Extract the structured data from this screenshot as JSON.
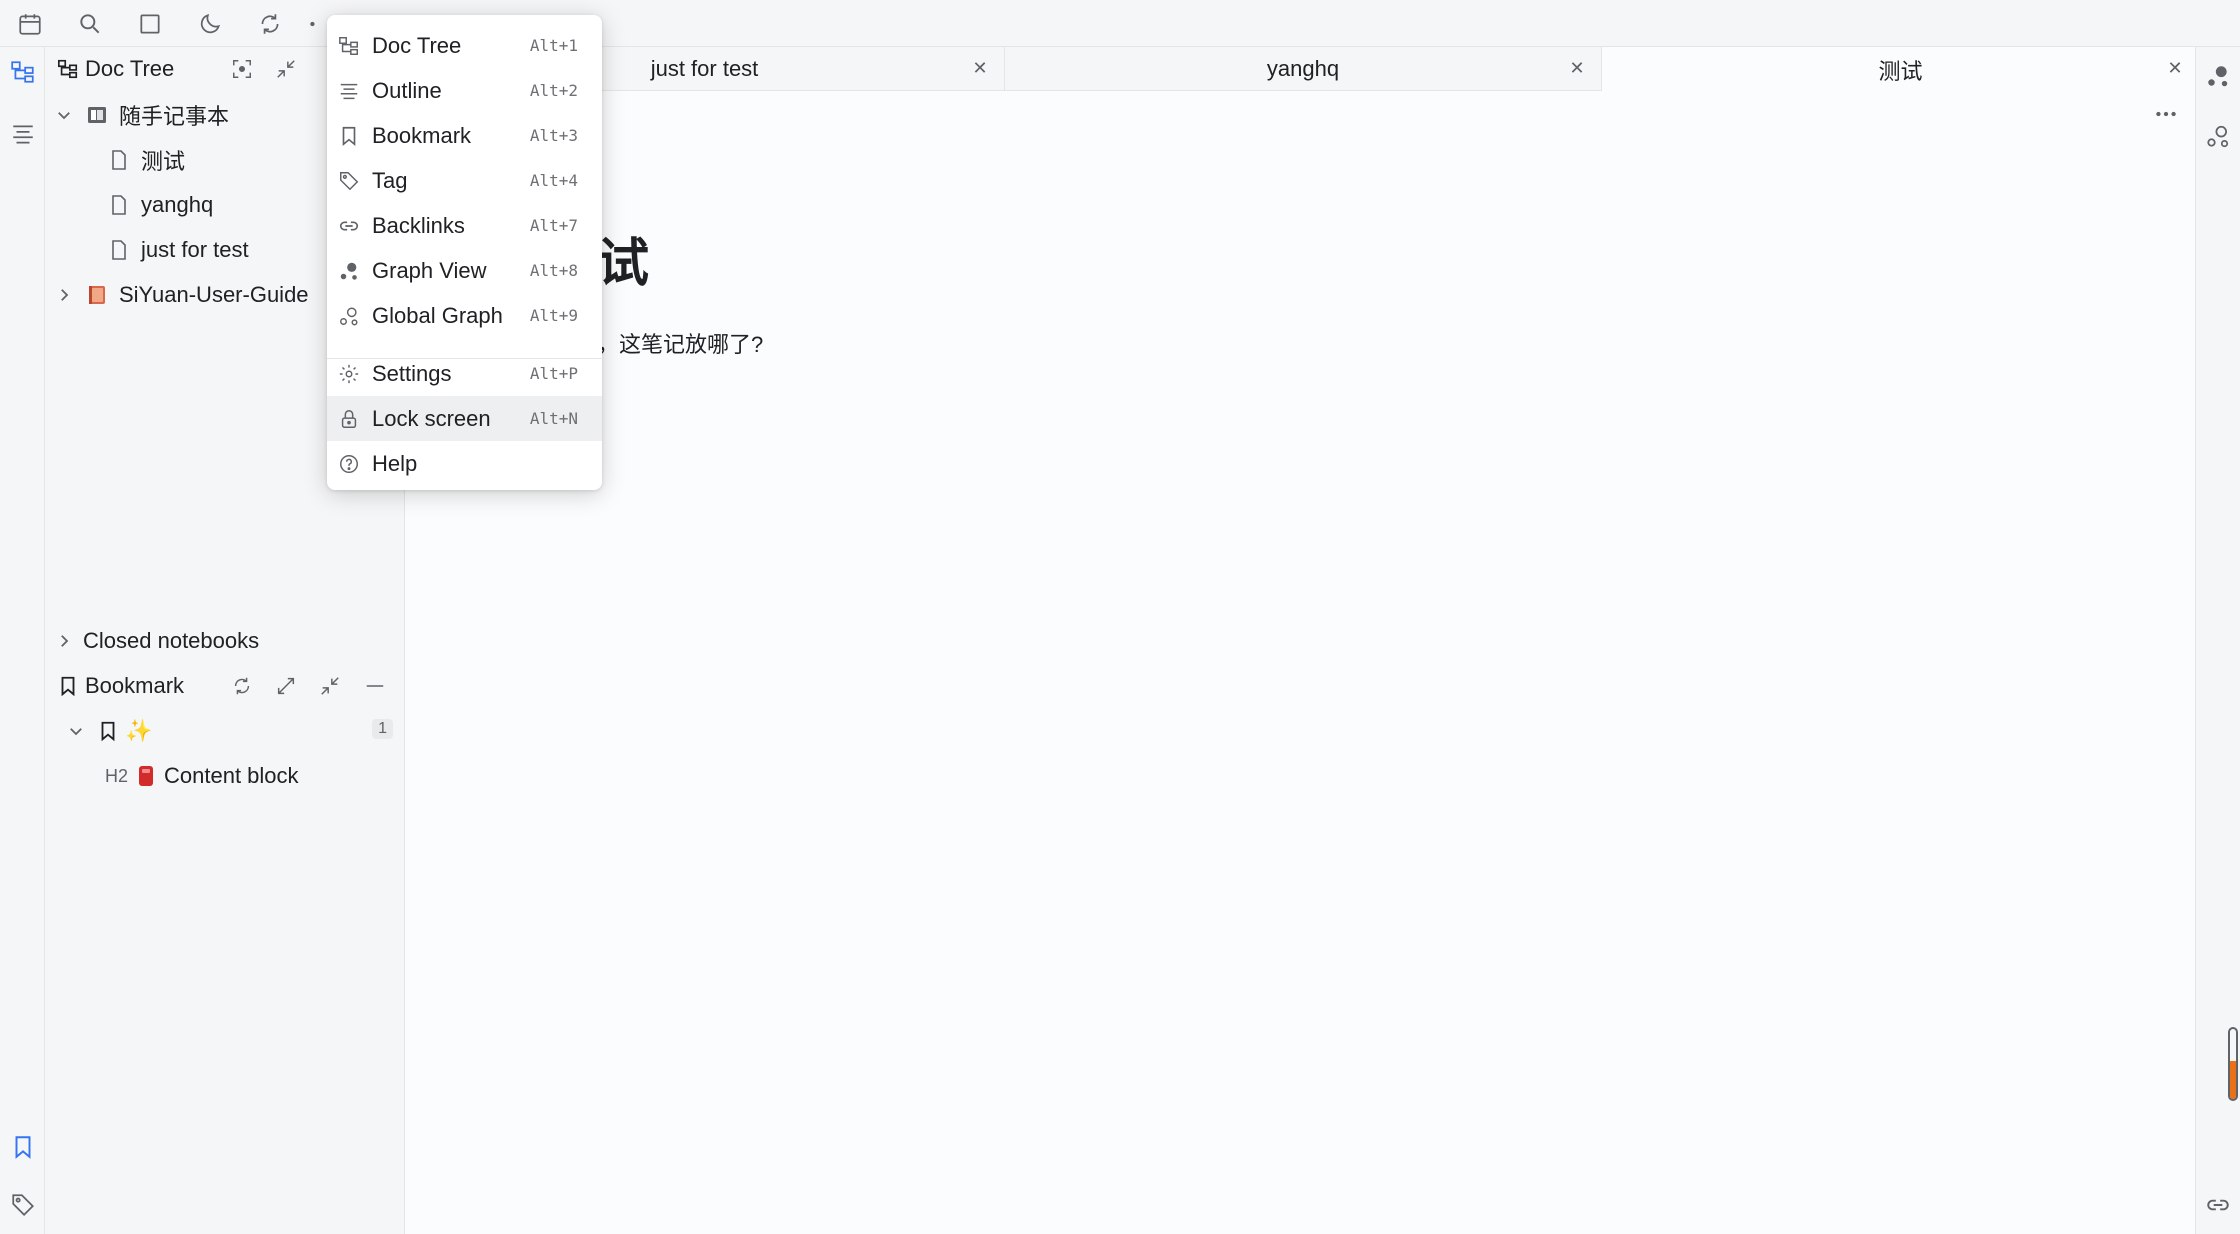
{
  "toolbar": {
    "icons": [
      "calendar-icon",
      "search-icon",
      "square-icon",
      "moon-icon",
      "sync-icon",
      "more-icon"
    ]
  },
  "menu": {
    "items": [
      {
        "label": "Doc Tree",
        "shortcut": "Alt+1",
        "icon": "doc-tree-icon"
      },
      {
        "label": "Outline",
        "shortcut": "Alt+2",
        "icon": "outline-icon"
      },
      {
        "label": "Bookmark",
        "shortcut": "Alt+3",
        "icon": "bookmark-icon"
      },
      {
        "label": "Tag",
        "shortcut": "Alt+4",
        "icon": "tag-icon"
      },
      {
        "label": "Backlinks",
        "shortcut": "Alt+7",
        "icon": "link-icon"
      },
      {
        "label": "Graph View",
        "shortcut": "Alt+8",
        "icon": "graph-icon"
      },
      {
        "label": "Global Graph",
        "shortcut": "Alt+9",
        "icon": "global-graph-icon"
      },
      {
        "label": "Settings",
        "shortcut": "Alt+P",
        "icon": "gear-icon"
      },
      {
        "label": "Lock screen",
        "shortcut": "Alt+N",
        "icon": "lock-icon"
      },
      {
        "label": "Help",
        "shortcut": "",
        "icon": "help-icon"
      }
    ]
  },
  "doctree": {
    "title": "Doc Tree",
    "notebooks": [
      {
        "name": "随手记事本",
        "expanded": true,
        "docs": [
          "测试",
          "yanghq",
          "just for test"
        ]
      },
      {
        "name": "SiYuan-User-Guide",
        "expanded": false,
        "docs": []
      }
    ],
    "closed_label": "Closed notebooks"
  },
  "bookmark": {
    "title": "Bookmark",
    "group_emoji": "✨",
    "count": "1",
    "item_heading": "H2",
    "item_label": "Content block"
  },
  "tabs": [
    {
      "label": "just for test",
      "active": false
    },
    {
      "label": "yanghq",
      "active": false
    },
    {
      "label": "测试",
      "active": true
    }
  ],
  "editor": {
    "title_visible": "试",
    "paragraph_visible": "，这笔记放哪了?"
  },
  "colors": {
    "accent": "#3575f0",
    "background": "#fbfcfd",
    "panel": "#f5f6f7",
    "scroll_fill": "#e8711a"
  },
  "scroll_progress": 0.55
}
